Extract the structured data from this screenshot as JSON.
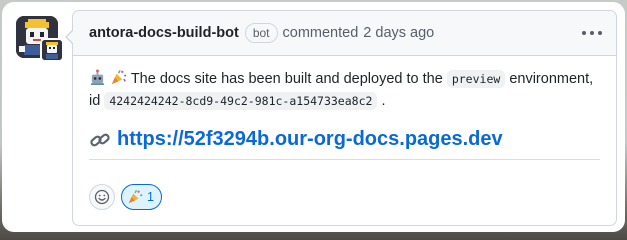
{
  "comment": {
    "author": "antora-docs-build-bot",
    "badge": "bot",
    "action": "commented",
    "time": "2 days ago",
    "message": {
      "text_before": "The docs site has been built and deployed to the",
      "environment": "preview",
      "text_mid": "environment, id",
      "id": "4242424242-8cd9-49c2-981c-a154733ea8c2",
      "text_end": "."
    },
    "link": "https://52f3294b.our-org-docs.pages.dev"
  },
  "reactions": [
    {
      "icon": "party-popper-icon",
      "count": "1"
    }
  ],
  "colors": {
    "link": "#0969da",
    "reaction_border": "#0969da",
    "reaction_bg": "#ddf4ff",
    "header_bg": "#f6f8fa",
    "border": "#d0d7de"
  }
}
